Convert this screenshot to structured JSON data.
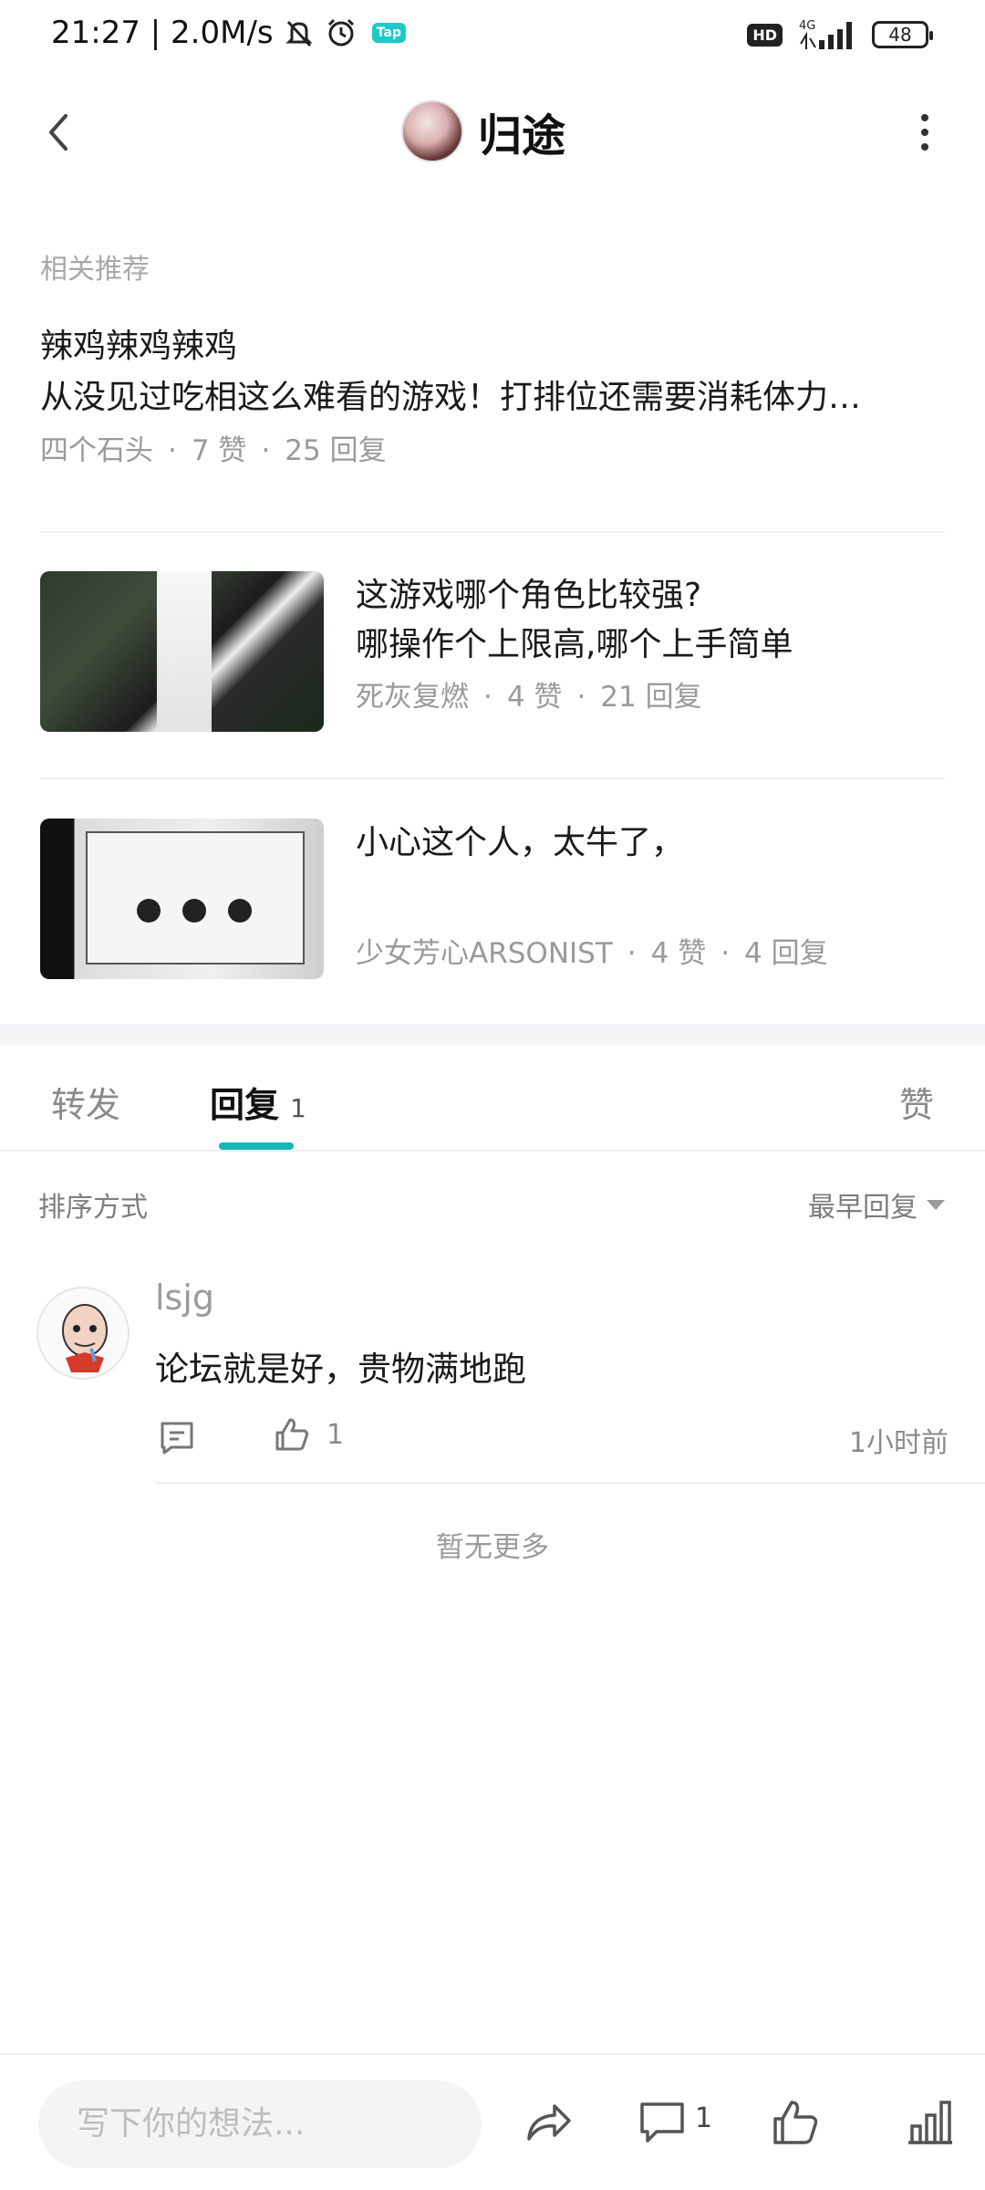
{
  "status_bar": {
    "time_speed": "21:27 | 2.0M/s",
    "tap_badge": "Tap",
    "hd_badge": "HD",
    "network": "4G",
    "battery": "48"
  },
  "header": {
    "title": "归途"
  },
  "related": {
    "section_title": "相关推荐",
    "posts": [
      {
        "title_line1": "辣鸡辣鸡辣鸡",
        "title_line2": "从没见过吃相这么难看的游戏！打排位还需要消耗体力…",
        "author": "四个石头",
        "likes": "7 赞",
        "replies": "25 回复"
      },
      {
        "title_line1": "这游戏哪个角色比较强?",
        "title_line2": "哪操作个上限高,哪个上手简单",
        "author": "死灰复燃",
        "likes": "4 赞",
        "replies": "21 回复"
      },
      {
        "title_line1": "小心这个人，太牛了，",
        "author": "少女芳心ARSONIST",
        "likes": "4 赞",
        "replies": "4 回复"
      }
    ]
  },
  "tabs": {
    "forward": "转发",
    "reply": "回复",
    "reply_count": "1",
    "like": "赞"
  },
  "sort": {
    "label": "排序方式",
    "selected": "最早回复"
  },
  "comments": [
    {
      "user": "lsjg",
      "text": "论坛就是好，贵物满地跑",
      "likes": "1",
      "time": "1小时前"
    }
  ],
  "no_more": "暂无更多",
  "bottom_bar": {
    "compose_placeholder": "写下你的想法...",
    "comment_count": "1"
  },
  "icons": {
    "back": "back-arrow-icon",
    "more": "more-vertical-icon",
    "share": "share-icon",
    "comment": "comment-icon",
    "like": "thumbs-up-icon",
    "stats": "stats-icon"
  },
  "colors": {
    "accent": "#17b5b5",
    "muted_text": "#9a9a9a",
    "section_bg": "#f3f5f7"
  }
}
